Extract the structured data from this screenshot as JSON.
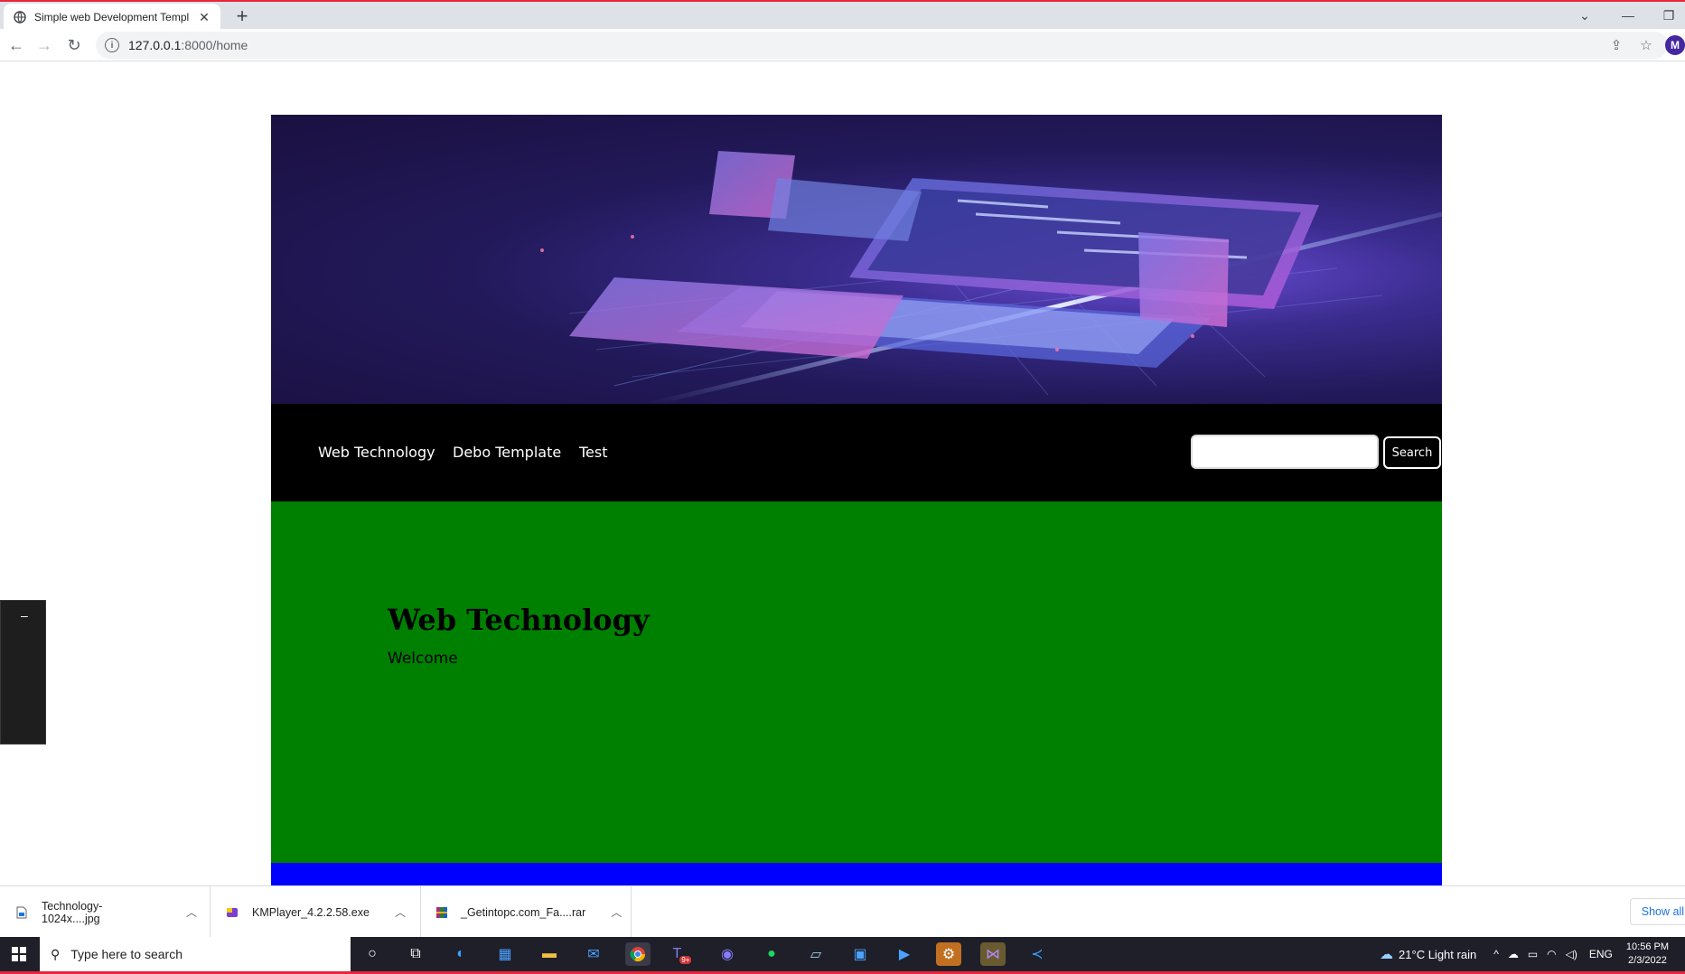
{
  "browser": {
    "tab_title": "Simple web Development Templ",
    "url_host": "127.0.0.1",
    "url_rest": ":8000/home",
    "profile_initial": "M"
  },
  "site": {
    "nav": [
      "Web Technology",
      "Debo Template",
      "Test"
    ],
    "search_button": "Search",
    "search_value": "",
    "heading": "Web Technology",
    "subtext": "Welcome",
    "colors": {
      "navbar": "#000000",
      "content": "#008000",
      "footer": "#0000ff"
    }
  },
  "downloads": [
    {
      "name": "Technology-1024x....jpg",
      "icon": "image-file-icon"
    },
    {
      "name": "KMPlayer_4.2.2.58.exe",
      "icon": "kmplayer-icon"
    },
    {
      "name": "_Getintopc.com_Fa....rar",
      "icon": "winrar-icon"
    }
  ],
  "show_all": "Show all",
  "taskbar": {
    "search_placeholder": "Type here to search",
    "weather": "21°C  Light rain",
    "language": "ENG",
    "time": "10:56 PM",
    "date": "2/3/2022",
    "teams_badge": "9+"
  }
}
